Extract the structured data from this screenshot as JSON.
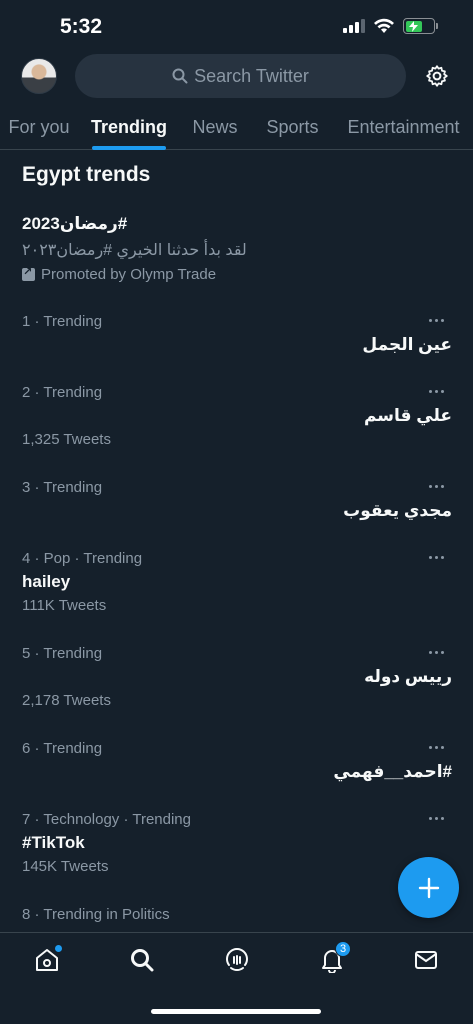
{
  "status": {
    "time": "5:32"
  },
  "header": {
    "search_placeholder": "Search Twitter"
  },
  "tabs": [
    {
      "label": "For you",
      "active": false
    },
    {
      "label": "Trending",
      "active": true
    },
    {
      "label": "News",
      "active": false
    },
    {
      "label": "Sports",
      "active": false
    },
    {
      "label": "Entertainment",
      "active": false
    }
  ],
  "section_title": "Egypt trends",
  "promo": {
    "title": "#رمضان2023",
    "description": "لقد بدأ حدثنا الخيري #رمضان٢٠٢٣",
    "promoted_by": "Promoted by Olymp Trade"
  },
  "trends": [
    {
      "meta": "1 · Trending",
      "name": "عين الجمل",
      "count": ""
    },
    {
      "meta": "2 · Trending",
      "name": "علي قاسم",
      "count": "1,325 Tweets"
    },
    {
      "meta": "3 · Trending",
      "name": "مجدي يعقوب",
      "count": ""
    },
    {
      "meta": "4 · Pop · Trending",
      "name": "hailey",
      "count": "111K Tweets"
    },
    {
      "meta": "5 · Trending",
      "name": "رييس دوله",
      "count": "2,178 Tweets"
    },
    {
      "meta": "6 · Trending",
      "name": "#احمد__فهمي",
      "count": ""
    },
    {
      "meta": "7 · Technology · Trending",
      "name": "#TikTok",
      "count": "145K Tweets"
    },
    {
      "meta": "8 · Trending in Politics",
      "name": "",
      "count": ""
    }
  ],
  "nav": {
    "notifications_badge": "3"
  },
  "colors": {
    "accent": "#1d9bf0",
    "background": "#15202b",
    "muted": "#8b98a5"
  }
}
